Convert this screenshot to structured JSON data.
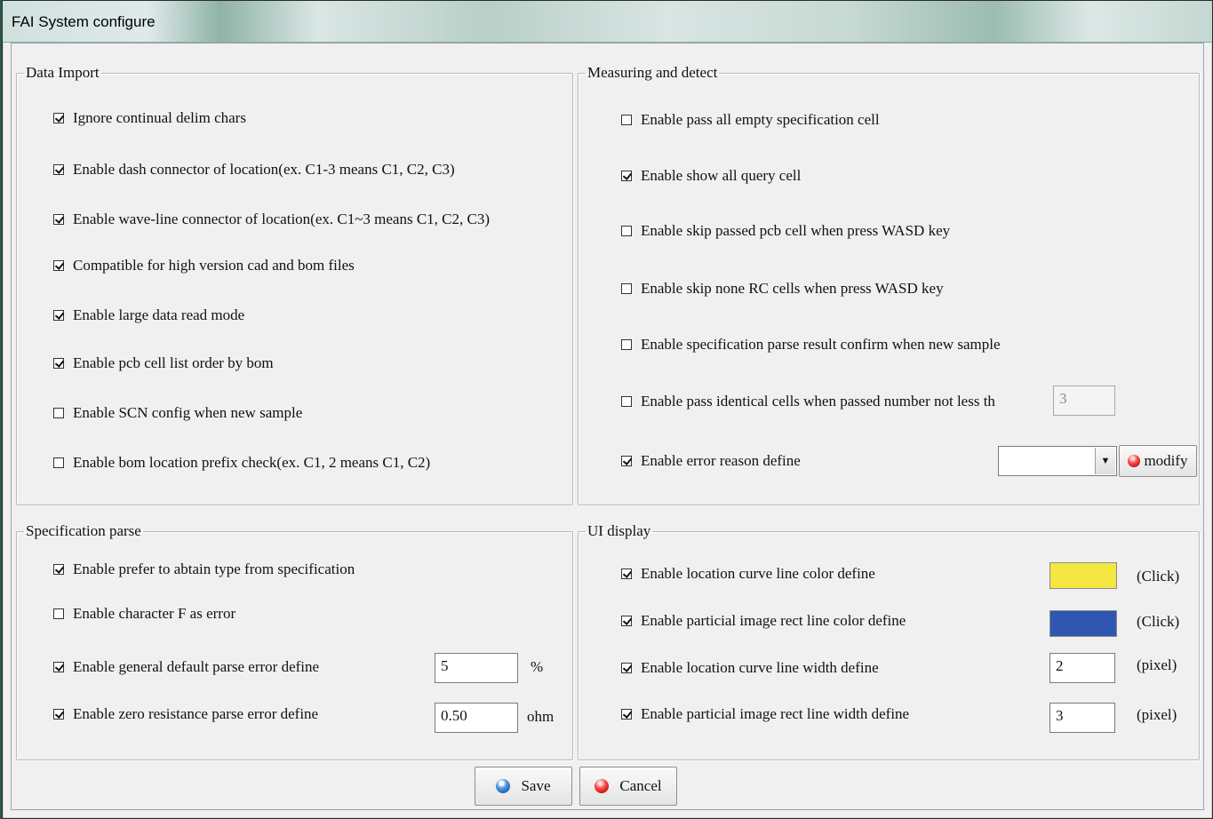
{
  "window": {
    "title": "FAI System configure"
  },
  "data_import": {
    "legend": "Data Import",
    "items": [
      {
        "label": "Ignore continual delim chars",
        "checked": true
      },
      {
        "label": "Enable dash connector of location(ex. C1-3 means C1, C2, C3)",
        "checked": true
      },
      {
        "label": "Enable wave-line connector of location(ex. C1~3 means C1, C2, C3)",
        "checked": true
      },
      {
        "label": "Compatible for high version cad and bom files",
        "checked": true
      },
      {
        "label": "Enable large data read mode",
        "checked": true
      },
      {
        "label": "Enable pcb cell list order by bom",
        "checked": true
      },
      {
        "label": "Enable SCN config when new sample",
        "checked": false
      },
      {
        "label": "Enable bom location prefix check(ex. C1, 2 means C1, C2)",
        "checked": false
      }
    ]
  },
  "measuring": {
    "legend": "Measuring and detect",
    "items": [
      {
        "label": "Enable pass all empty specification cell",
        "checked": false
      },
      {
        "label": "Enable show all query cell",
        "checked": true
      },
      {
        "label": "Enable skip passed pcb cell when press WASD key",
        "checked": false
      },
      {
        "label": "Enable skip none RC cells when press WASD key",
        "checked": false
      },
      {
        "label": "Enable specification parse result confirm when new sample",
        "checked": false
      },
      {
        "label": "Enable pass identical cells when passed number not less th",
        "checked": false
      },
      {
        "label": "Enable error reason define",
        "checked": true
      }
    ],
    "identical_count": "3",
    "error_reason_selected": "",
    "modify_label": "modify"
  },
  "spec_parse": {
    "legend": "Specification parse",
    "items": [
      {
        "label": "Enable prefer to abtain type from specification",
        "checked": true
      },
      {
        "label": "Enable character F as error",
        "checked": false
      },
      {
        "label": "Enable general default parse error define",
        "checked": true
      },
      {
        "label": "Enable zero resistance parse error define",
        "checked": true
      }
    ],
    "general_error_value": "5",
    "general_error_unit": "%",
    "zero_res_value": "0.50",
    "zero_res_unit": "ohm"
  },
  "ui_display": {
    "legend": "UI display",
    "items": [
      {
        "label": "Enable location curve line color define",
        "checked": true
      },
      {
        "label": "Enable particial image rect line color define",
        "checked": true
      },
      {
        "label": "Enable location curve line width define",
        "checked": true
      },
      {
        "label": "Enable particial image rect line width define",
        "checked": true
      }
    ],
    "curve_color": "#f5e642",
    "rect_color": "#2f57b0",
    "click_label": "(Click)",
    "curve_width": "2",
    "rect_width": "3",
    "pixel_label": "(pixel)"
  },
  "footer": {
    "save_label": "Save",
    "cancel_label": "Cancel"
  }
}
